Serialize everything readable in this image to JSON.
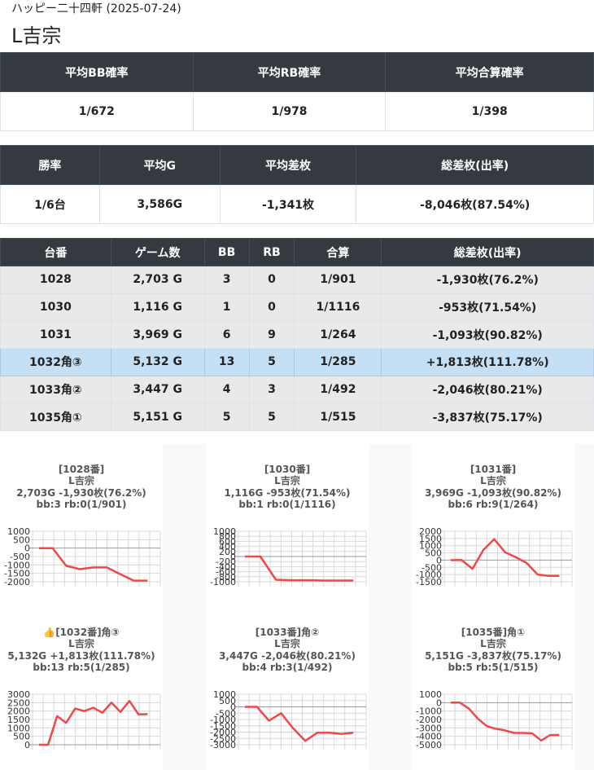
{
  "header": {
    "subtitle": "ハッピー二十四軒 (2025-07-24)",
    "title": "L吉宗"
  },
  "summary1": {
    "headers": [
      "平均BB確率",
      "平均RB確率",
      "平均合算確率"
    ],
    "values": [
      "1/672",
      "1/978",
      "1/398"
    ]
  },
  "summary2": {
    "headers": [
      "勝率",
      "平均G",
      "平均差枚",
      "総差枚(出率)"
    ],
    "values": [
      "1/6台",
      "3,586G",
      "-1,341枚",
      "-8,046枚(87.54%)"
    ]
  },
  "machines": {
    "headers": [
      "台番",
      "ゲーム数",
      "BB",
      "RB",
      "合算",
      "総差枚(出率)"
    ],
    "rows": [
      [
        "1028",
        "2,703 G",
        "3",
        "0",
        "1/901",
        "-1,930枚(76.2%)"
      ],
      [
        "1030",
        "1,116 G",
        "1",
        "0",
        "1/1116",
        "-953枚(71.54%)"
      ],
      [
        "1031",
        "3,969 G",
        "6",
        "9",
        "1/264",
        "-1,093枚(90.82%)"
      ],
      [
        "1032角③",
        "5,132 G",
        "13",
        "5",
        "1/285",
        "+1,813枚(111.78%)"
      ],
      [
        "1033角②",
        "3,447 G",
        "4",
        "3",
        "1/492",
        "-2,046枚(80.21%)"
      ],
      [
        "1035角①",
        "5,151 G",
        "5",
        "5",
        "1/515",
        "-3,837枚(75.17%)"
      ]
    ],
    "highlight_row": 3
  },
  "graphs": [
    {
      "caption": [
        "[1028番]",
        "L吉宗",
        "2,703G -1,930枚(76.2%)",
        "bb:3 rb:0(1/901)"
      ],
      "ylim": [
        -2000,
        1000
      ],
      "yticks": [
        "1000",
        "500",
        "0",
        "-500",
        "-1000",
        "-1500",
        "-2000"
      ],
      "yvals": [
        1000,
        500,
        0,
        -500,
        -1000,
        -1500,
        -2000
      ],
      "series": [
        0,
        0,
        -1050,
        -1250,
        -1150,
        -1150,
        -1550,
        -1930,
        -1930
      ]
    },
    {
      "caption": [
        "[1030番]",
        "L吉宗",
        "1,116G -953枚(71.54%)",
        "bb:1 rb:0(1/1116)"
      ],
      "ylim": [
        -1000,
        1000
      ],
      "yticks": [
        "1000",
        "800",
        "600",
        "400",
        "200",
        "0",
        "-200",
        "-400",
        "-600",
        "-800",
        "-1000"
      ],
      "yvals": [
        1000,
        800,
        600,
        400,
        200,
        0,
        -200,
        -400,
        -600,
        -800,
        -1000
      ],
      "series": [
        0,
        0,
        -920,
        -940,
        -940,
        -950,
        -953,
        -953
      ]
    },
    {
      "caption": [
        "[1031番]",
        "L吉宗",
        "3,969G -1,093枚(90.82%)",
        "bb:6 rb:9(1/264)"
      ],
      "ylim": [
        -1500,
        2000
      ],
      "yticks": [
        "2000",
        "1500",
        "1000",
        "500",
        "0",
        "-500",
        "-1000",
        "-1500"
      ],
      "yvals": [
        2000,
        1500,
        1000,
        500,
        0,
        -500,
        -1000,
        -1500
      ],
      "series": [
        0,
        0,
        -600,
        700,
        1450,
        550,
        200,
        -200,
        -1000,
        -1093,
        -1093
      ]
    },
    {
      "caption": [
        "👍[1032番]角③",
        "L吉宗",
        "5,132G +1,813枚(111.78%)",
        "bb:13 rb:5(1/285)"
      ],
      "ylim": [
        0,
        3000
      ],
      "yticks": [
        "3000",
        "2500",
        "2000",
        "1500",
        "1000",
        "500",
        "0"
      ],
      "yvals": [
        3000,
        2500,
        2000,
        1500,
        1000,
        500,
        0
      ],
      "series": [
        0,
        0,
        1700,
        1300,
        2150,
        2000,
        2200,
        1900,
        2500,
        1950,
        2600,
        1800,
        1813
      ]
    },
    {
      "caption": [
        "[1033番]角②",
        "L吉宗",
        "3,447G -2,046枚(80.21%)",
        "bb:4 rb:3(1/492)"
      ],
      "ylim": [
        -3000,
        1000
      ],
      "yticks": [
        "1000",
        "500",
        "0",
        "-500",
        "-1000",
        "-1500",
        "-2000",
        "-2500",
        "-3000"
      ],
      "yvals": [
        1000,
        500,
        0,
        -500,
        -1000,
        -1500,
        -2000,
        -2500,
        -3000
      ],
      "series": [
        0,
        0,
        -1100,
        -500,
        -1700,
        -2700,
        -2050,
        -2050,
        -2150,
        -2046
      ]
    },
    {
      "caption": [
        "[1035番]角①",
        "L吉宗",
        "5,151G -3,837枚(75.17%)",
        "bb:5 rb:5(1/515)"
      ],
      "ylim": [
        -5000,
        1000
      ],
      "yticks": [
        "1000",
        "0",
        "-1000",
        "-2000",
        "-3000",
        "-4000",
        "-5000"
      ],
      "yvals": [
        1000,
        0,
        -1000,
        -2000,
        -3000,
        -4000,
        -5000
      ],
      "series": [
        0,
        0,
        -700,
        -1900,
        -2800,
        -3100,
        -3300,
        -3600,
        -3600,
        -3650,
        -4500,
        -3850,
        -3837
      ]
    }
  ],
  "colors": {
    "header_bg": "#343a40",
    "row_bg": "#e9e9e9",
    "highlight_bg": "#c5dff5",
    "line": "#f04848"
  }
}
